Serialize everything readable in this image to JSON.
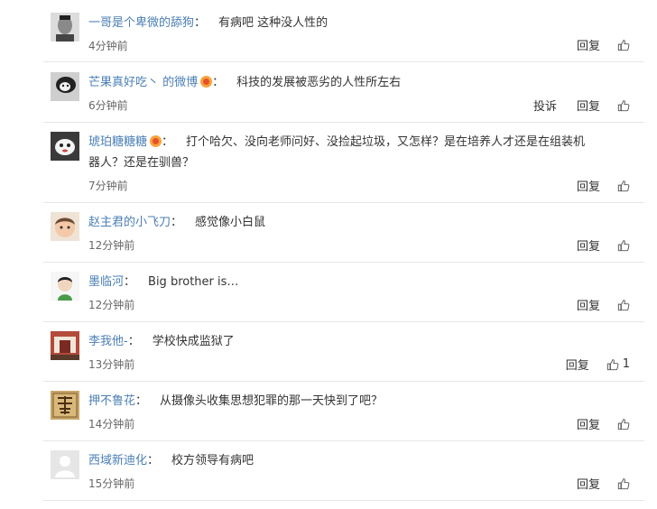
{
  "colors": {
    "username": "#4b7fb5",
    "text": "#333333",
    "meta": "#666666",
    "divider": "#e6e6e6"
  },
  "comments": [
    {
      "user": "一哥是个卑微的舔狗",
      "sep": "：",
      "text": "有病吧 这种没人性的",
      "time": "4分钟前",
      "reply_label": "回复",
      "like_icon": "thumbs-up-icon"
    },
    {
      "user": "芒果真好吃丶 的微博",
      "badge": "vip-badge-icon",
      "sep": "：",
      "text": "科技的发展被恶劣的人性所左右",
      "time": "6分钟前",
      "report_label": "投诉",
      "reply_label": "回复",
      "like_icon": "thumbs-up-icon"
    },
    {
      "user": "琥珀糖糖糖",
      "badge": "vip-badge-icon",
      "sep": "：",
      "text": "打个哈欠、没向老师问好、没捡起垃圾，又怎样？是在培养人才还是在组装机器人？还是在驯兽？",
      "time": "7分钟前",
      "reply_label": "回复",
      "like_icon": "thumbs-up-icon"
    },
    {
      "user": "赵主君的小飞刀",
      "sep": "：",
      "text": "感觉像小白鼠",
      "time": "12分钟前",
      "reply_label": "回复",
      "like_icon": "thumbs-up-icon"
    },
    {
      "user": "墨临河",
      "sep": "：",
      "text": "Big brother is…",
      "time": "12分钟前",
      "reply_label": "回复",
      "like_icon": "thumbs-up-icon"
    },
    {
      "user": "李我他-",
      "sep": "：",
      "text": "学校快成监狱了",
      "time": "13分钟前",
      "reply_label": "回复",
      "like_icon": "thumbs-up-icon",
      "like_count": "1"
    },
    {
      "user": "押不鲁花",
      "sep": "：",
      "text": "从摄像头收集思想犯罪的那一天快到了吧？",
      "time": "14分钟前",
      "reply_label": "回复",
      "like_icon": "thumbs-up-icon"
    },
    {
      "user": "西域新迪化",
      "sep": "：",
      "text": "校方领导有病吧",
      "time": "15分钟前",
      "reply_label": "回复",
      "like_icon": "thumbs-up-icon"
    }
  ]
}
